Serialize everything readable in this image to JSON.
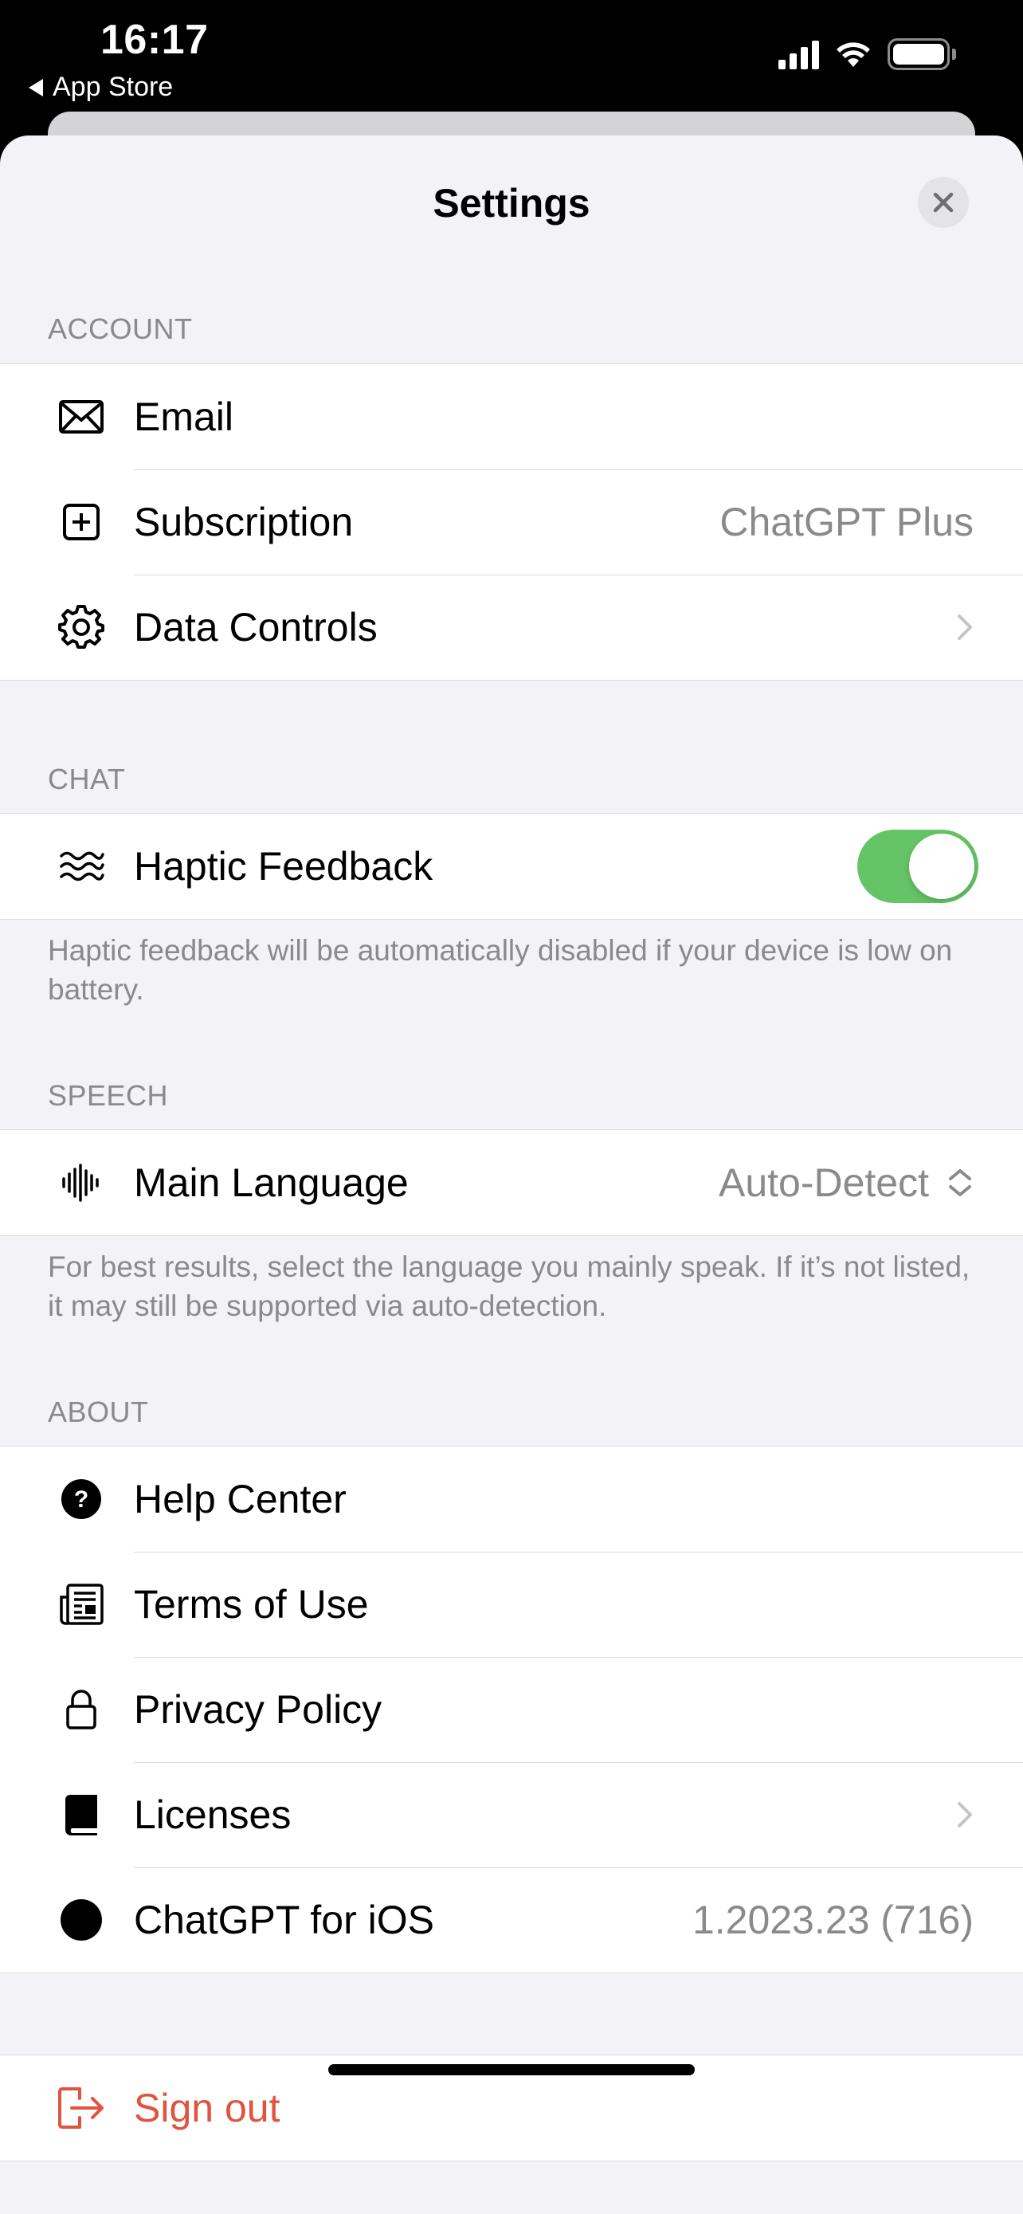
{
  "status_bar": {
    "time": "16:17",
    "back_app": "App Store"
  },
  "nav": {
    "title": "Settings"
  },
  "sections": {
    "account": {
      "header": "ACCOUNT",
      "rows": [
        {
          "label": "Email",
          "value": "",
          "icon": "envelope-icon"
        },
        {
          "label": "Subscription",
          "value": "ChatGPT Plus",
          "icon": "plus-square-icon"
        },
        {
          "label": "Data Controls",
          "value": "",
          "icon": "gear-icon"
        }
      ]
    },
    "chat": {
      "header": "CHAT",
      "rows": [
        {
          "label": "Haptic Feedback",
          "icon": "waves-icon",
          "toggle_on": true
        }
      ],
      "footer": "Haptic feedback will be automatically disabled if your device is low on battery."
    },
    "speech": {
      "header": "SPEECH",
      "rows": [
        {
          "label": "Main Language",
          "value": "Auto-Detect",
          "icon": "waveform-icon"
        }
      ],
      "footer": "For best results, select the language you mainly speak. If it’s not listed, it may still be supported via auto-detection."
    },
    "about": {
      "header": "ABOUT",
      "rows": [
        {
          "label": "Help Center",
          "icon": "question-circle-icon"
        },
        {
          "label": "Terms of Use",
          "icon": "document-icon"
        },
        {
          "label": "Privacy Policy",
          "icon": "lock-icon"
        },
        {
          "label": "Licenses",
          "icon": "book-icon"
        },
        {
          "label": "ChatGPT for iOS",
          "value": "1.2023.23 (716)",
          "icon": "openai-logo-icon"
        }
      ]
    },
    "signout": {
      "label": "Sign out",
      "icon": "sign-out-icon"
    }
  },
  "colors": {
    "background": "#f2f2f7",
    "toggle_on": "#65c466",
    "destructive": "#e0533e",
    "secondary_text": "#8a8a8e"
  }
}
